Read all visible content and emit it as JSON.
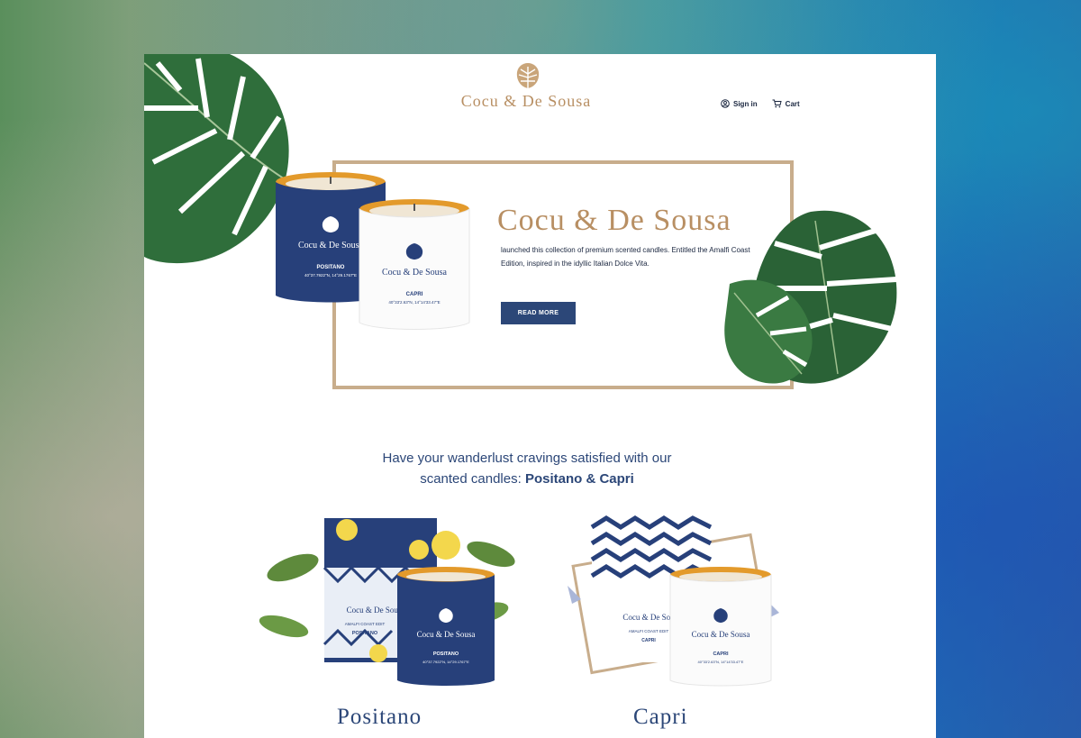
{
  "brand": {
    "logo_text": "Cocu & De Sousa"
  },
  "nav": {
    "signin": "Sign in",
    "cart": "Cart"
  },
  "hero": {
    "title": "Cocu & De Sousa",
    "text": "launched this collection of premium scented candles. Entitled the Amalfi Coast Edition, inspired in the idyllic Italian Dolce Vita.",
    "button": "READ MORE"
  },
  "hero_candles": [
    {
      "brand": "Cocu & De Sousa",
      "name": "POSITANO",
      "coords": "40°37.7922\"N, 14°29.1767\"E"
    },
    {
      "brand": "Cocu & De Sousa",
      "name": "CAPRI",
      "coords": "40°33'2.63\"N, 14°14'33.47\"E"
    }
  ],
  "tagline": {
    "line1": "Have your wanderlust cravings satisfied with our",
    "line2_pre": "scanted candles: ",
    "line2_bold": "Positano & Capri"
  },
  "products": [
    {
      "title": "Positano",
      "candle_brand": "Cocu & De Sousa",
      "candle_name": "POSITANO",
      "candle_coords": "40°37.7922\"N, 14°29.1767\"E",
      "box_brand": "Cocu & De Sousa",
      "box_edition": "AMALFI COAST EDIT",
      "box_name": "POSITANO"
    },
    {
      "title": "Capri",
      "candle_brand": "Cocu & De Sousa",
      "candle_name": "CAPRI",
      "candle_coords": "40°33'2.63\"N, 14°14'33.47\"E",
      "box_brand": "Cocu & De Sou",
      "box_edition": "AMALFI COAST EDIT",
      "box_name": "CAPRI"
    }
  ],
  "colors": {
    "gold": "#b88f63",
    "navy": "#2c4778",
    "leaf": "#2d6a3a"
  }
}
